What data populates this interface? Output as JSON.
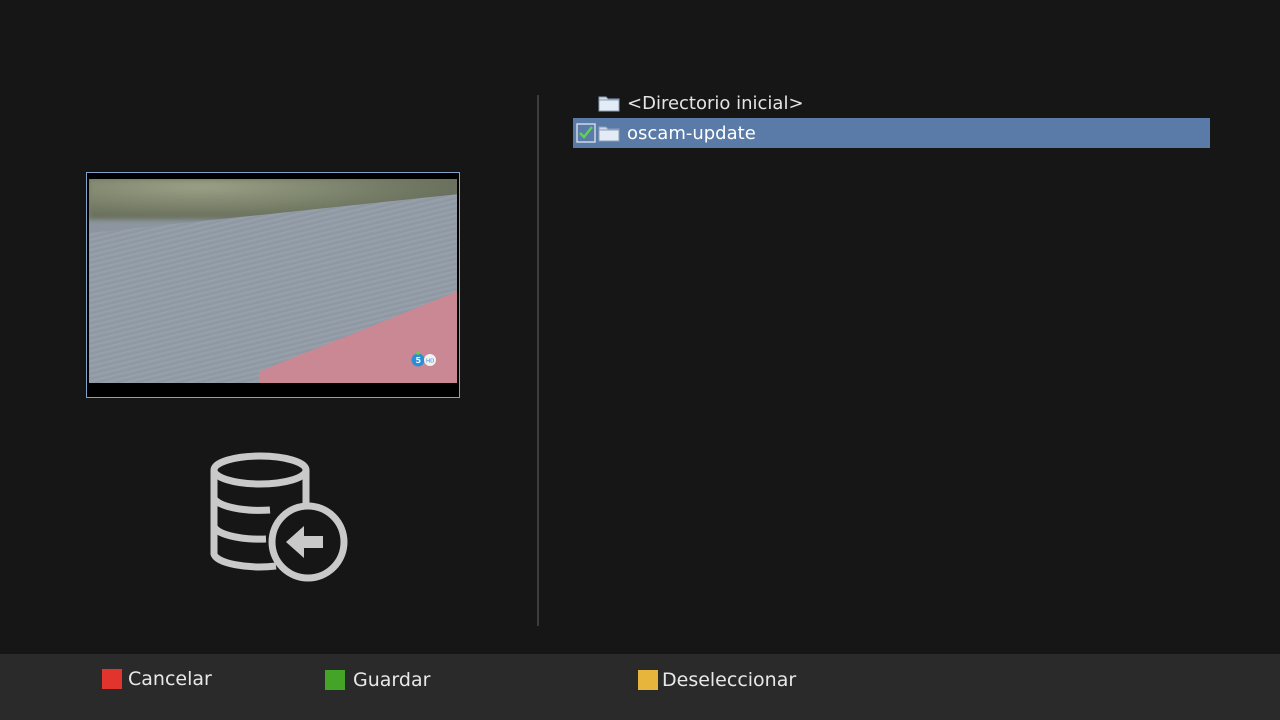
{
  "file_list": {
    "items": [
      {
        "label": "<Directorio inicial>",
        "checked": false,
        "selected": false,
        "icon": "folder-icon"
      },
      {
        "label": "oscam-update",
        "checked": true,
        "selected": true,
        "icon": "folder-icon"
      }
    ]
  },
  "color_keys": {
    "red": {
      "label": "Cancelar",
      "color": "#e0342c"
    },
    "green": {
      "label": "Guardar",
      "color": "#43a428"
    },
    "yellow": {
      "label": "Deseleccionar",
      "color": "#e8b53c"
    }
  },
  "preview": {
    "channel_logo_text": "5 HD"
  },
  "decoration": {
    "main_icon": "database-restore-icon",
    "selection_color": "#5a7aa8"
  }
}
